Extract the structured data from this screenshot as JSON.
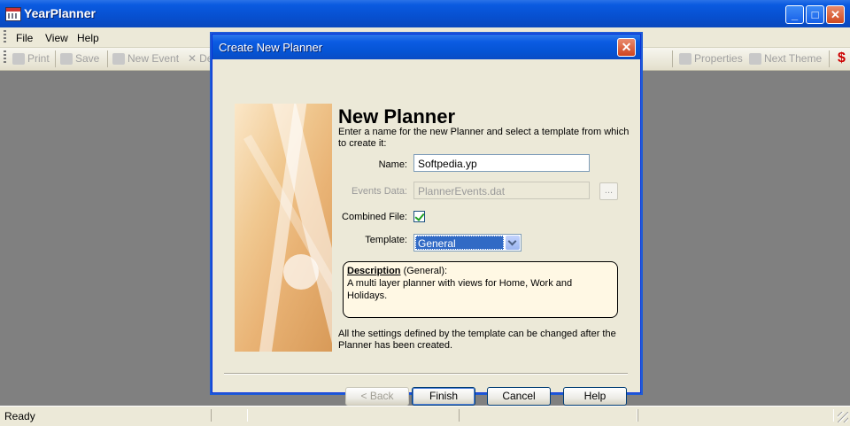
{
  "window": {
    "title": "YearPlanner"
  },
  "menu": [
    "File",
    "View",
    "Help"
  ],
  "toolbar": {
    "print": "Print",
    "save": "Save",
    "new_event": "New Event",
    "delete_partial": "De",
    "properties": "Properties",
    "next_theme": "Next Theme",
    "dollar": "$"
  },
  "status": {
    "text": "Ready"
  },
  "dialog": {
    "title": "Create New Planner",
    "close": "✕",
    "heading": "New Planner",
    "intro": "Enter a name for the new Planner and select a template from which to create it:",
    "name_label": "Name:",
    "name_value": "Softpedia.yp",
    "events_label": "Events Data:",
    "events_value": "PlannerEvents.dat",
    "browse_label": "...",
    "combined_label": "Combined File:",
    "combined_checked": true,
    "template_label": "Template:",
    "template_value": "General",
    "description_title": "Description",
    "description_sub": " (General):",
    "description_text": "A multi layer planner with views for Home, Work and Holidays.",
    "footer_note": "All the settings defined by the template can be changed after the Planner has been created.",
    "buttons": {
      "back": "< Back",
      "finish": "Finish",
      "cancel": "Cancel",
      "help": "Help"
    }
  }
}
